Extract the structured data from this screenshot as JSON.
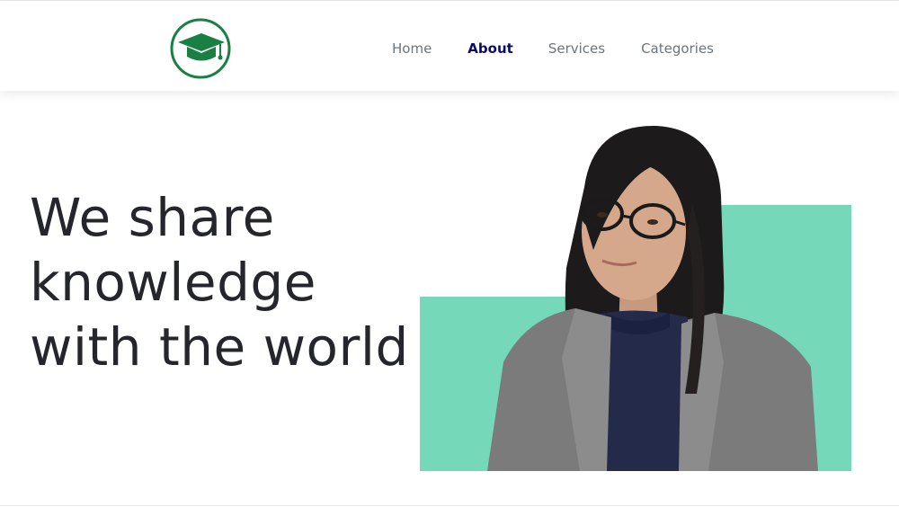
{
  "logo": {
    "icon": "graduation-cap-icon",
    "color": "#1a7f43"
  },
  "nav": {
    "items": [
      {
        "label": "Home",
        "active": false
      },
      {
        "label": "About",
        "active": true
      },
      {
        "label": "Services",
        "active": false
      },
      {
        "label": "Categories",
        "active": false
      }
    ]
  },
  "hero": {
    "title_line1": "We share",
    "title_line2": "knowledge",
    "title_line3": "with the world"
  },
  "colors": {
    "accent_green": "#75d8b9",
    "active_nav": "#0b0b6f",
    "nav_text": "#6c757d",
    "heading": "#24262b"
  }
}
